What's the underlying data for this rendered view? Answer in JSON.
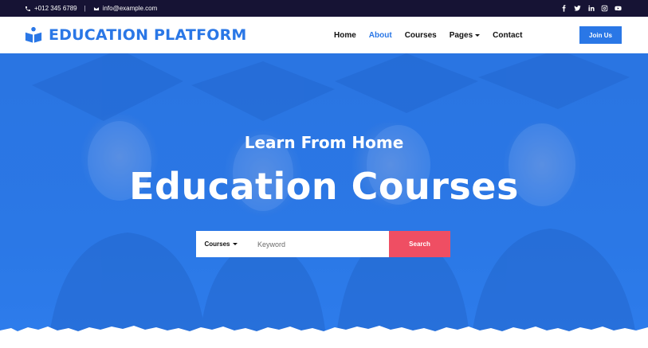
{
  "topbar": {
    "phone": "+012 345 6789",
    "separator": "|",
    "email": "info@example.com",
    "social": [
      "facebook-icon",
      "twitter-icon",
      "linkedin-icon",
      "instagram-icon",
      "youtube-icon"
    ]
  },
  "brand": {
    "name": "EDUCATION PLATFORM",
    "icon": "book-reader-icon",
    "color": "#2a77e6"
  },
  "nav": {
    "items": [
      {
        "label": "Home",
        "active": false
      },
      {
        "label": "About",
        "active": true
      },
      {
        "label": "Courses",
        "active": false
      },
      {
        "label": "Pages",
        "active": false,
        "dropdown": true
      },
      {
        "label": "Contact",
        "active": false
      }
    ],
    "cta": "Join Us"
  },
  "hero": {
    "subtitle": "Learn From Home",
    "title": "Education Courses",
    "search": {
      "category": "Courses",
      "placeholder": "Keyword",
      "button": "Search"
    }
  },
  "colors": {
    "topbar_bg": "#161334",
    "accent": "#2a77e6",
    "search_button": "#ef4e63",
    "hero_overlay": "#2b78e6"
  }
}
